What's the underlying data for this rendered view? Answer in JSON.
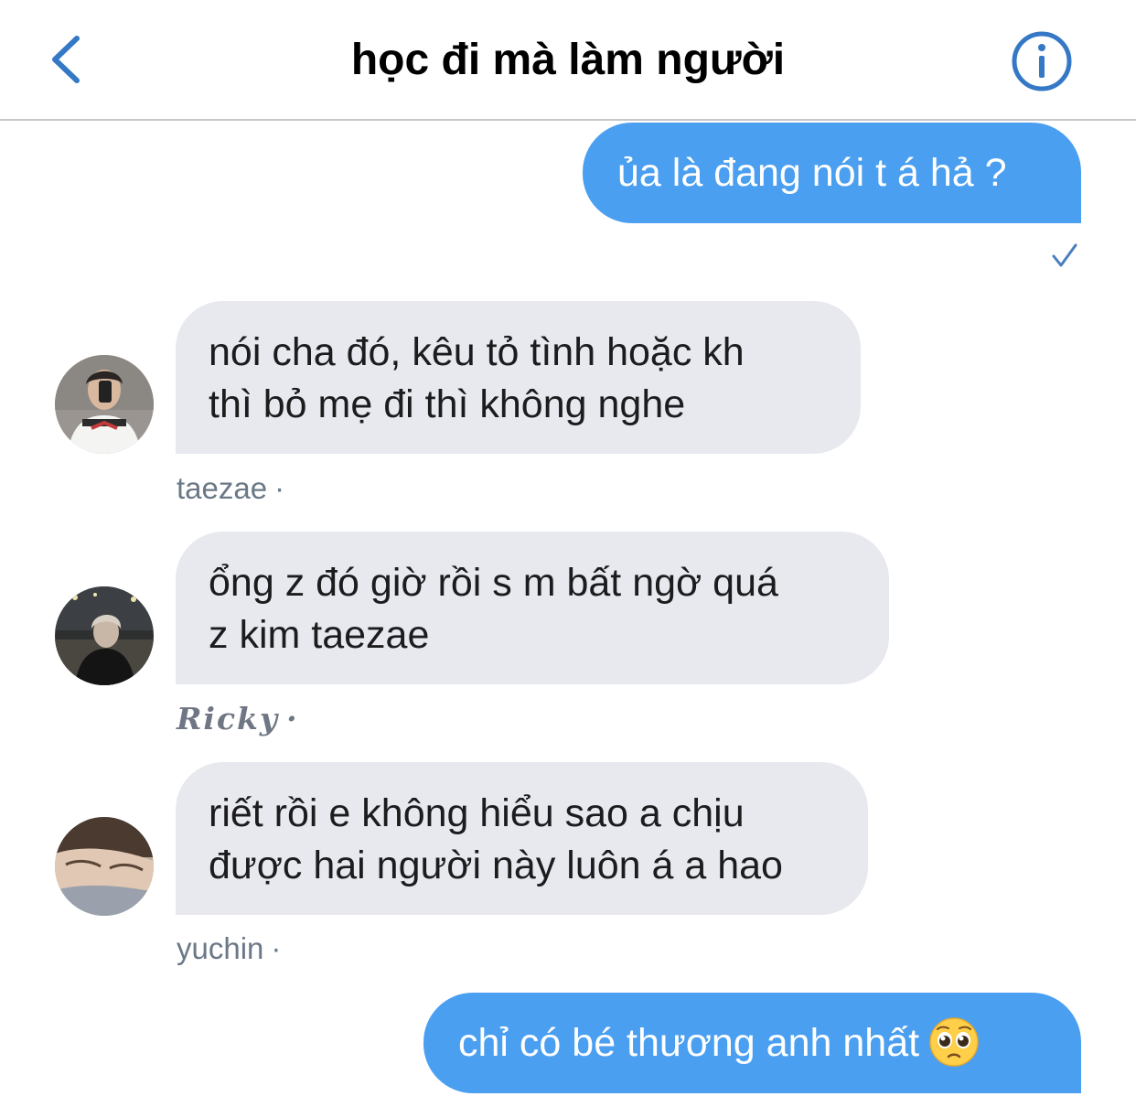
{
  "header": {
    "title": "học đi mà làm người",
    "back_icon": "chevron-left-icon",
    "info_icon": "info-circle-icon",
    "accent_color": "#3478c6"
  },
  "messages": [
    {
      "direction": "outgoing",
      "text": "ủa là đang nói t á hả ?",
      "status_icon": "checkmark-icon"
    },
    {
      "direction": "incoming",
      "lines": [
        "nói cha đó, kêu tỏ tình hoặc kh",
        "thì bỏ mẹ đi thì không nghe"
      ],
      "sender": "taezae",
      "separator": "·"
    },
    {
      "direction": "incoming",
      "lines": [
        "ổng z đó giờ rồi s m bất ngờ quá",
        "z kim taezae"
      ],
      "sender": "Ricky",
      "separator": "·"
    },
    {
      "direction": "incoming",
      "lines": [
        "riết rồi e không hiểu sao a chịu",
        "được hai người này luôn á a hao"
      ],
      "sender": "yuchin",
      "separator": "·"
    },
    {
      "direction": "outgoing",
      "text": "chỉ có bé thương anh nhất",
      "emoji": "pleading-face-emoji"
    }
  ],
  "colors": {
    "outgoing_bubble": "#4a9ff0",
    "incoming_bubble": "#e7e9ef",
    "sender_text": "#6b7886"
  }
}
